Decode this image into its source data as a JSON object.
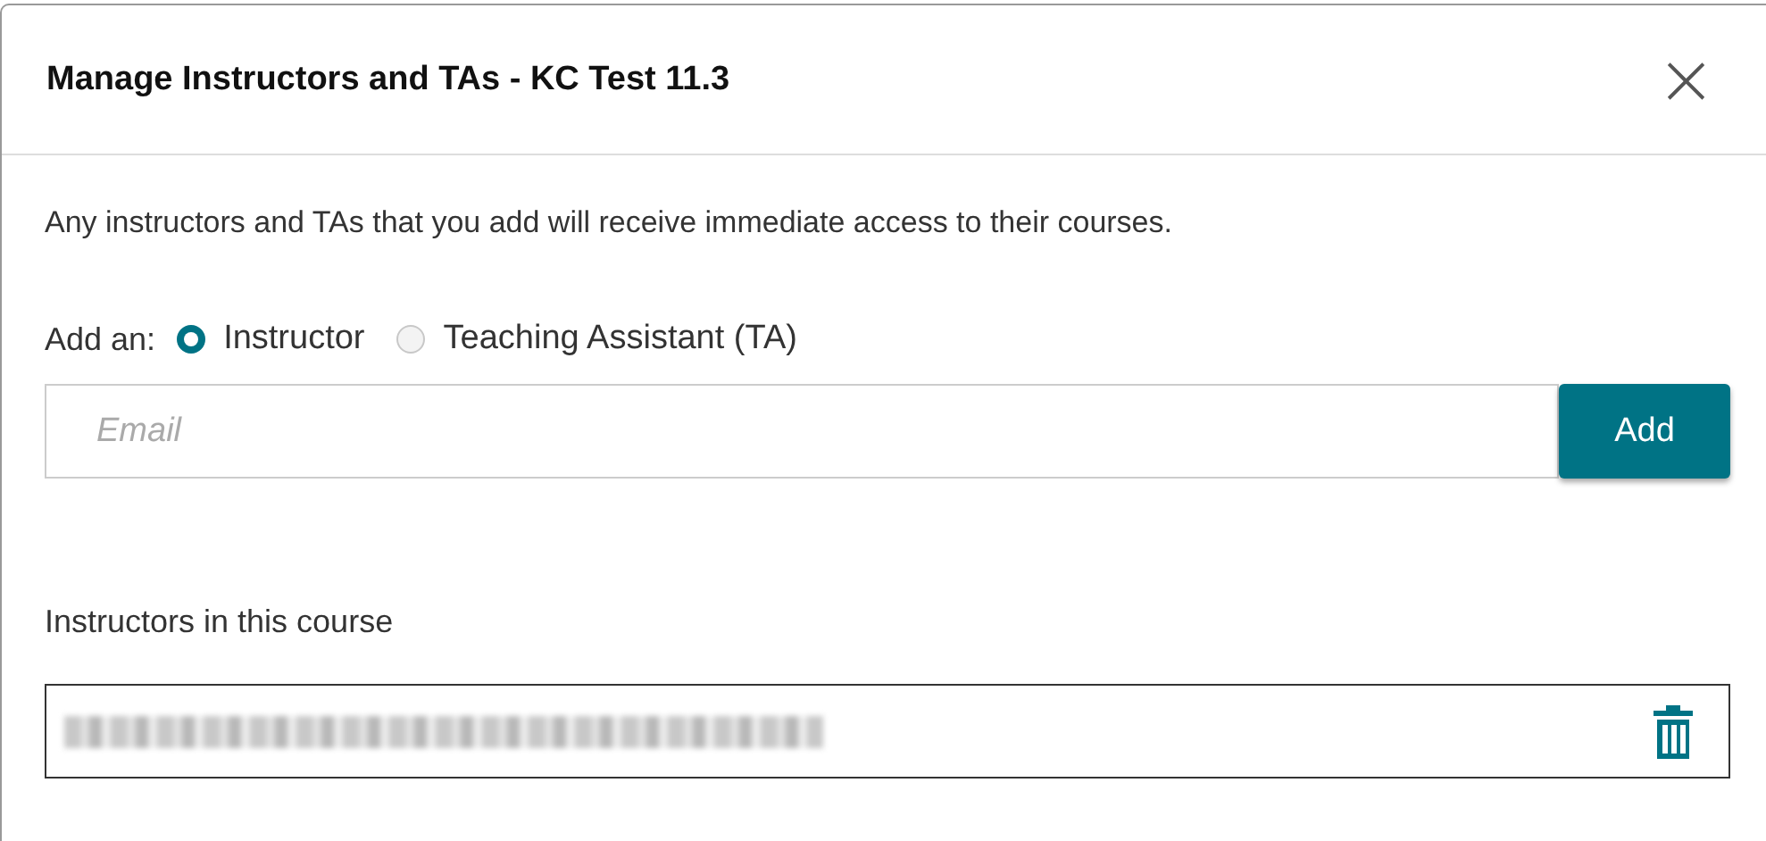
{
  "dialog": {
    "title": "Manage Instructors and TAs - KC Test 11.3",
    "close": "×"
  },
  "description": "Any instructors and TAs that you add will receive immediate access to their courses.",
  "role_picker": {
    "label": "Add an:",
    "options": [
      {
        "label": "Instructor",
        "selected": true
      },
      {
        "label": "Teaching Assistant (TA)",
        "selected": false
      }
    ]
  },
  "email_field": {
    "placeholder": "Email"
  },
  "add_button": "Add",
  "instructors": {
    "heading": "Instructors in this course",
    "rows": [
      {
        "kind": "redacted"
      }
    ]
  }
}
